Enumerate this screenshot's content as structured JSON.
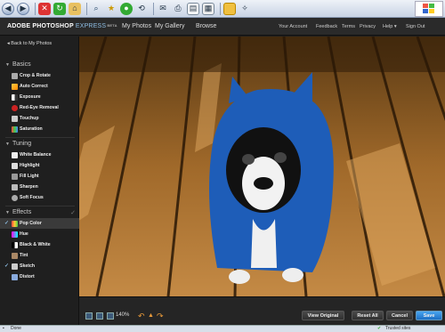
{
  "app": {
    "logo": "ADOBE PHOTOSHOP",
    "logo_express": "EXPRESS",
    "logo_beta": "BETA",
    "nav": [
      "My Photos",
      "My Gallery",
      "Browse"
    ],
    "account_links": [
      "Your Account",
      "Feedback",
      "Terms",
      "Privacy",
      "Help ▾",
      "Sign Out"
    ]
  },
  "sidebar": {
    "back_label": "◂ Back to My Photos",
    "sections": [
      {
        "label": "Basics",
        "items": [
          "Crop & Rotate",
          "Auto Correct",
          "Exposure",
          "Red-Eye Removal",
          "Touchup",
          "Saturation"
        ]
      },
      {
        "label": "Tuning",
        "items": [
          "White Balance",
          "Highlight",
          "Fill Light",
          "Sharpen",
          "Soft Focus"
        ]
      },
      {
        "label": "Effects",
        "items": [
          "Pop Color",
          "Hue",
          "Black & White",
          "Tint",
          "Sketch",
          "Distort"
        ]
      }
    ]
  },
  "bottom": {
    "zoom": "140%",
    "view_original": "View Original",
    "reset_all": "Reset All",
    "cancel": "Cancel",
    "save": "Save"
  },
  "status": {
    "left": "Done",
    "right": "Trusted sites"
  },
  "colors": {
    "accent": "#8fbfe6",
    "save": "#1d6fc4",
    "undo": "#e89a3a"
  }
}
